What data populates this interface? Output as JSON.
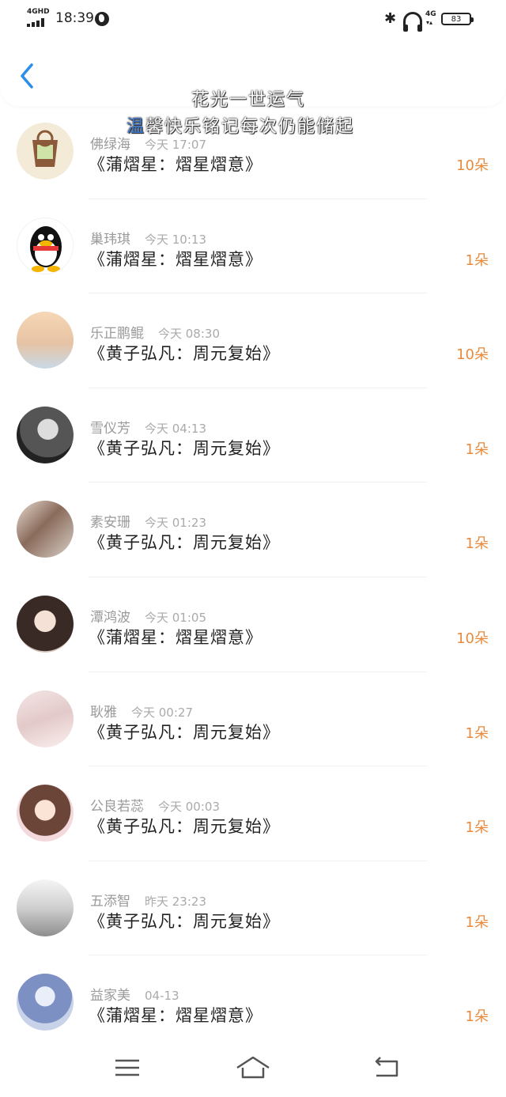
{
  "status_bar": {
    "network": "4GHD",
    "time": "18:39",
    "network_right": "4G",
    "battery": "83"
  },
  "header": {
    "overlay_line1": "花光一世运气",
    "overlay_line2_first": "温",
    "overlay_line2_rest": "馨快乐铭记每次仍能储起"
  },
  "items": [
    {
      "name": "佛绿海",
      "time": "今天 17:07",
      "title": "《蒲熠星：熠星熠意》",
      "count": "10朵"
    },
    {
      "name": "巢玮琪",
      "time": "今天 10:13",
      "title": "《蒲熠星：熠星熠意》",
      "count": "1朵"
    },
    {
      "name": "乐正鹏鲲",
      "time": "今天 08:30",
      "title": "《黄子弘凡：周元复始》",
      "count": "10朵"
    },
    {
      "name": "雪仪芳",
      "time": "今天 04:13",
      "title": "《黄子弘凡：周元复始》",
      "count": "1朵"
    },
    {
      "name": "素安珊",
      "time": "今天 01:23",
      "title": "《黄子弘凡：周元复始》",
      "count": "1朵"
    },
    {
      "name": "潭鸿波",
      "time": "今天 01:05",
      "title": "《蒲熠星：熠星熠意》",
      "count": "10朵"
    },
    {
      "name": "耿雅",
      "time": "今天 00:27",
      "title": "《黄子弘凡：周元复始》",
      "count": "1朵"
    },
    {
      "name": "公良若蕊",
      "time": "今天 00:03",
      "title": "《黄子弘凡：周元复始》",
      "count": "1朵"
    },
    {
      "name": "五添智",
      "time": "昨天 23:23",
      "title": "《黄子弘凡：周元复始》",
      "count": "1朵"
    },
    {
      "name": "益家美",
      "time": "04-13",
      "title": "《蒲熠星：熠星熠意》",
      "count": "1朵"
    }
  ],
  "colors": {
    "accent": "#2b8ee8",
    "count": "#e88a3c"
  }
}
